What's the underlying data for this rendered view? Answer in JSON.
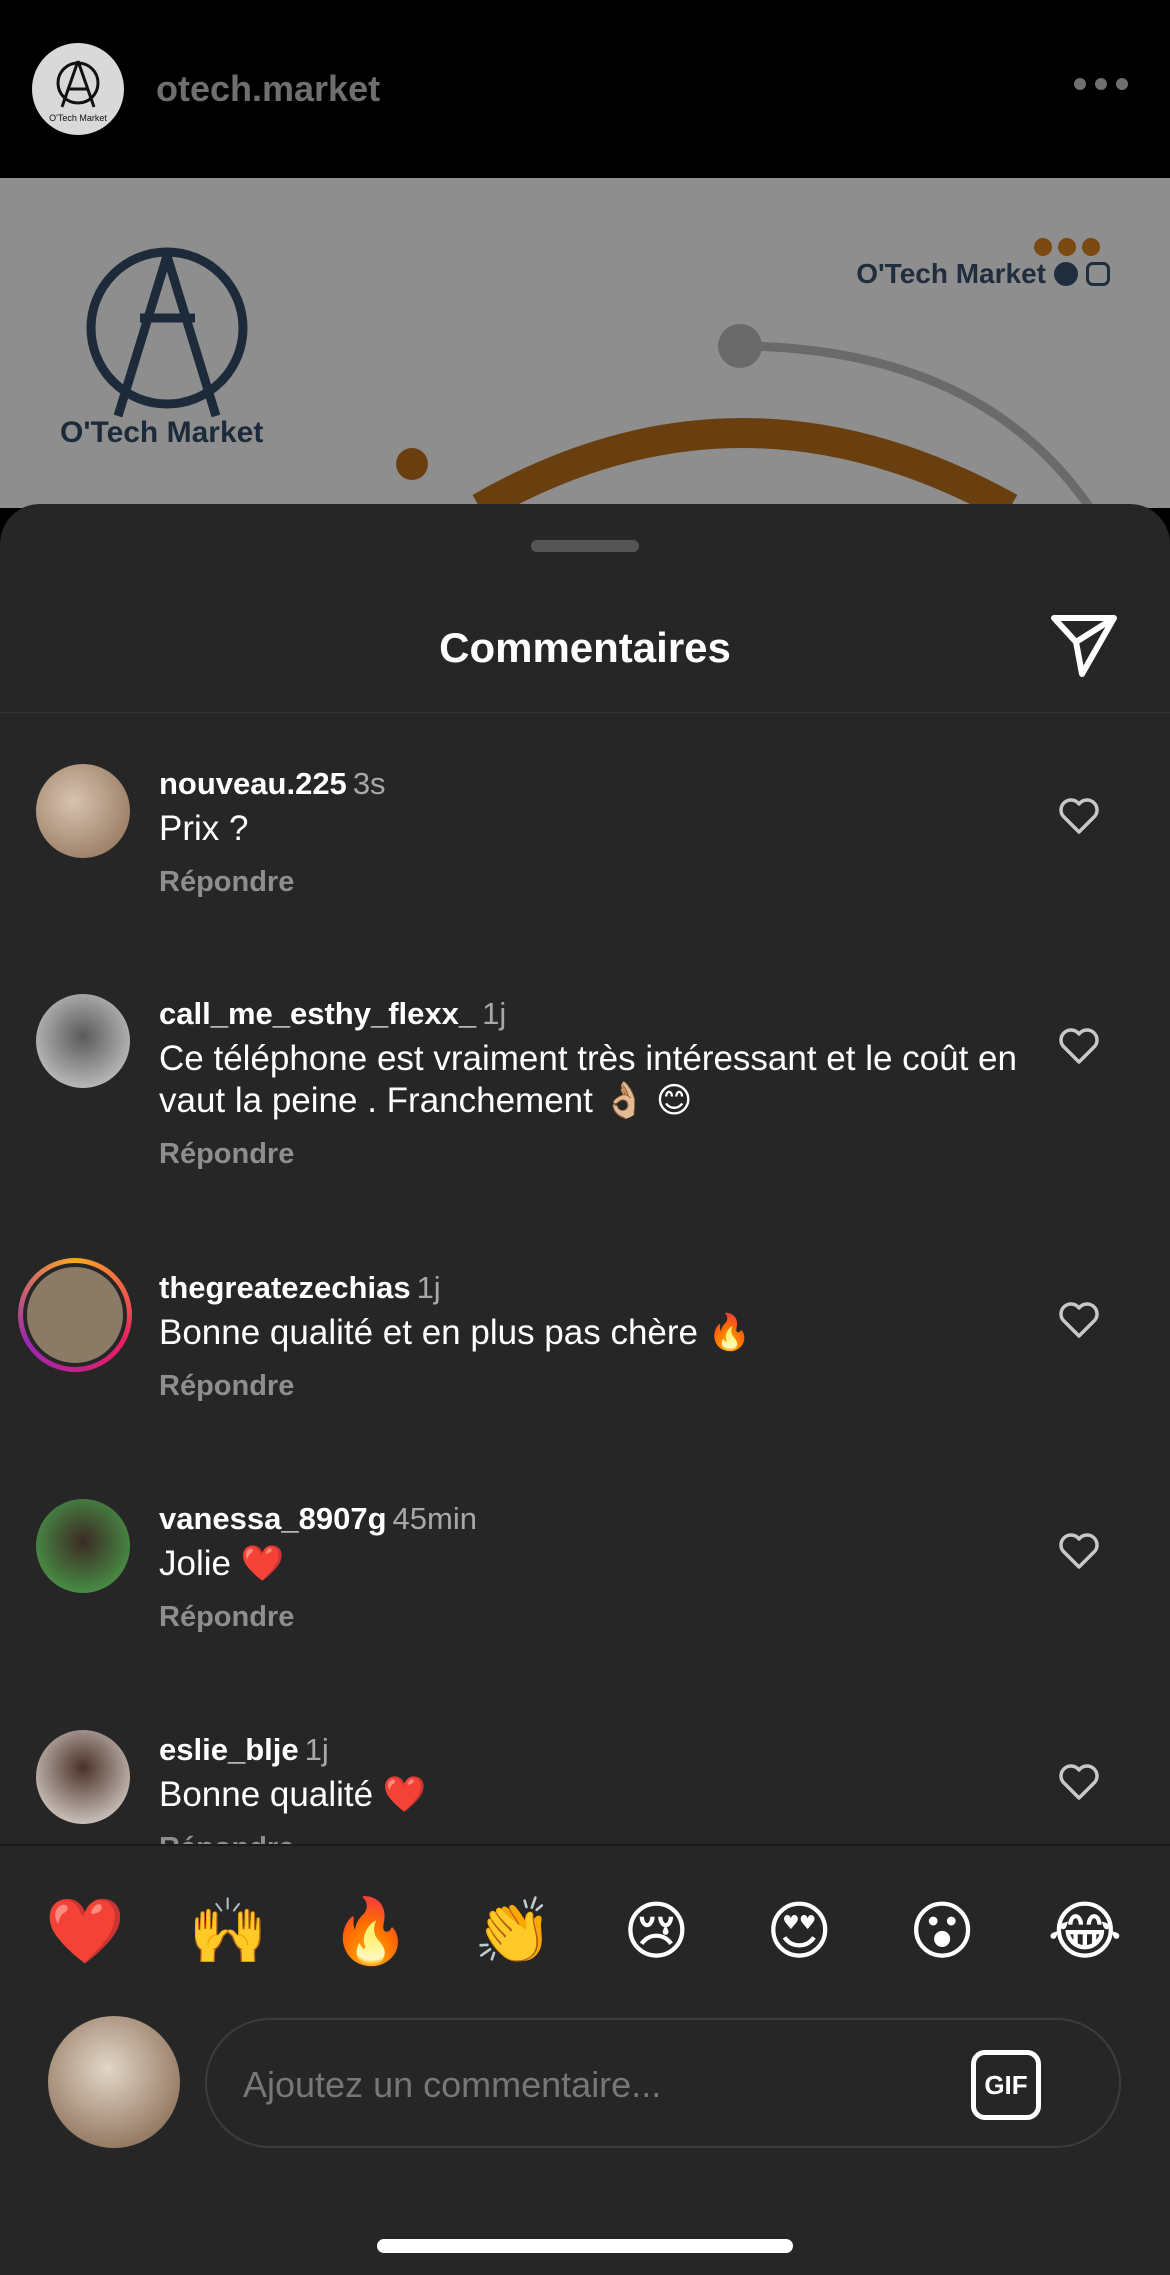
{
  "post": {
    "username": "otech.market",
    "avatar_caption": "O'Tech Market",
    "brand_name": "O'Tech Market",
    "logo_caption": "O'Tech Market"
  },
  "sheet": {
    "title": "Commentaires"
  },
  "comments": [
    {
      "username": "nouveau.225",
      "time": "3s",
      "text": "Prix ?",
      "reply_label": "Répondre"
    },
    {
      "username": "call_me_esthy_flexx_",
      "time": "1j",
      "text": "Ce téléphone est vraiment très intéressant et le coût en vaut la peine . Franchement 👌🏼 😊",
      "reply_label": "Répondre"
    },
    {
      "username": "thegreatezechias",
      "time": "1j",
      "text": "Bonne qualité et en plus pas chère 🔥",
      "reply_label": "Répondre"
    },
    {
      "username": "vanessa_8907g",
      "time": "45min",
      "text": "Jolie ❤️",
      "reply_label": "Répondre"
    },
    {
      "username": "eslie_blje",
      "time": "1j",
      "text": "Bonne qualité ❤️",
      "reply_label": "Répondre"
    }
  ],
  "quick_reactions": [
    "❤️",
    "🙌",
    "🔥",
    "👏",
    "😢",
    "😍",
    "😮",
    "😂"
  ],
  "composer": {
    "placeholder": "Ajoutez un commentaire...",
    "gif_label": "GIF"
  }
}
